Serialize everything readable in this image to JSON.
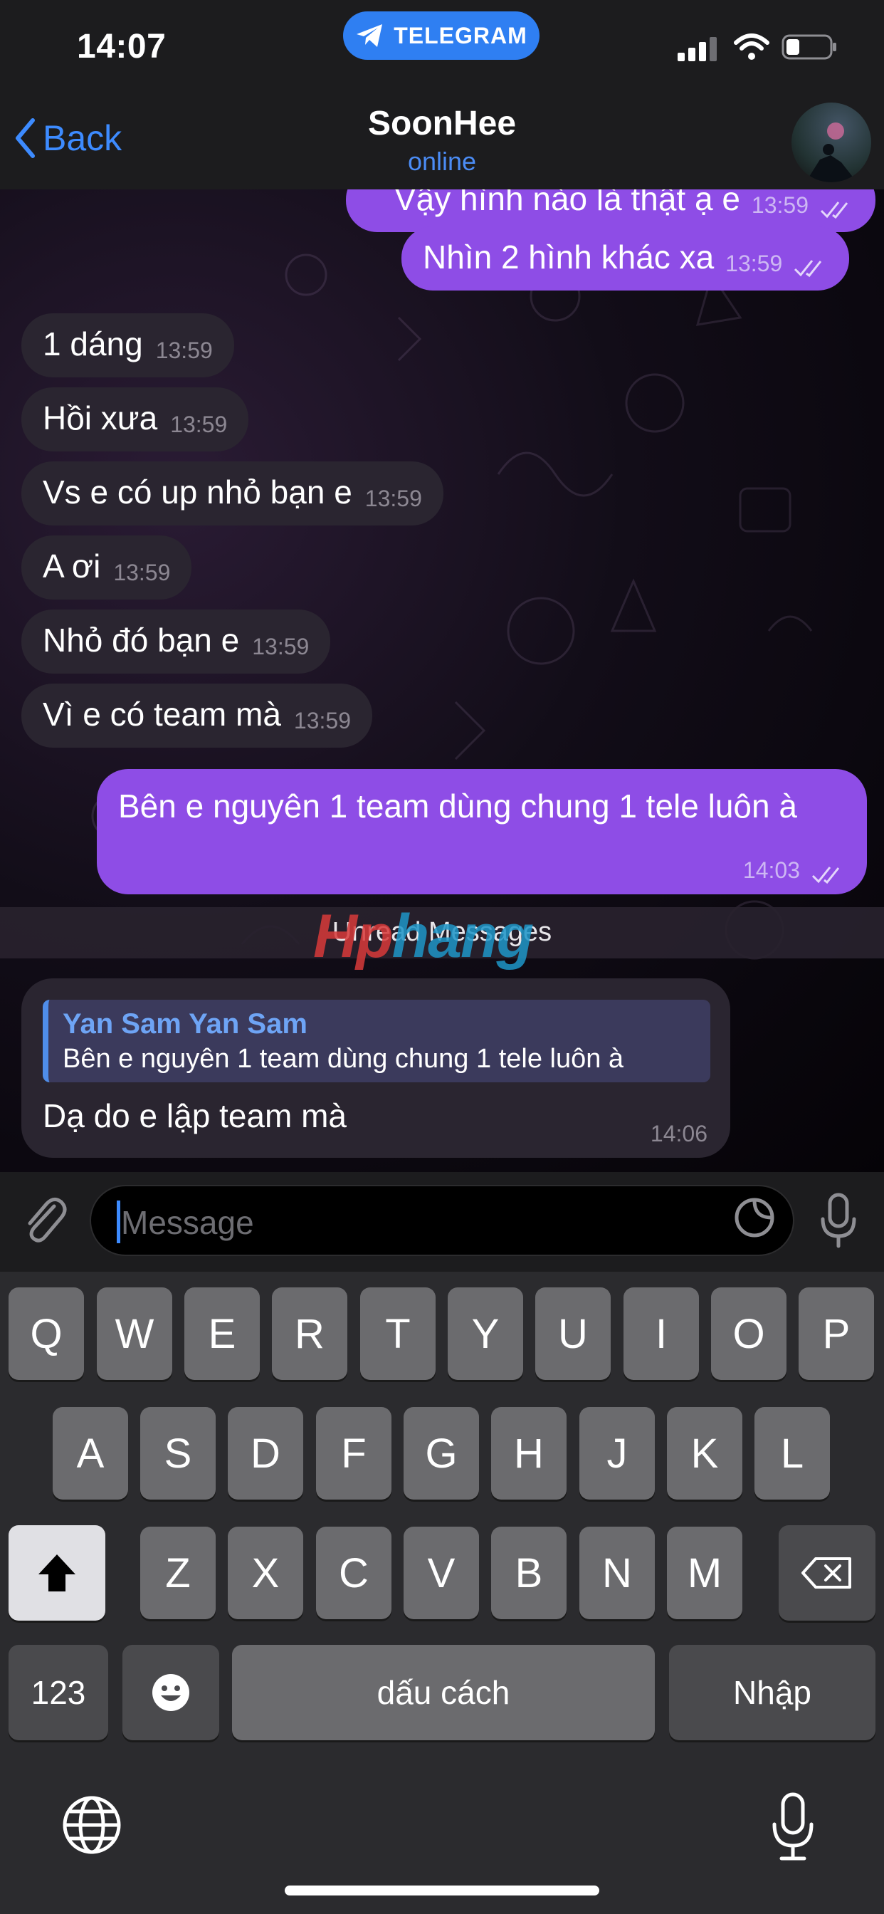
{
  "status_bar": {
    "time": "14:07",
    "app_pill": "TELEGRAM"
  },
  "header": {
    "back_label": "Back",
    "title": "SoonHee",
    "subtitle": "online"
  },
  "messages": [
    {
      "text": "Vậy hình nào là thật ạ e",
      "time": "13:59",
      "dir": "out"
    },
    {
      "text": "Nhìn 2 hình khác xa",
      "time": "13:59",
      "dir": "out"
    },
    {
      "text": "1 dáng",
      "time": "13:59",
      "dir": "in"
    },
    {
      "text": "Hồi xưa",
      "time": "13:59",
      "dir": "in"
    },
    {
      "text": "Vs e có up nhỏ bạn e",
      "time": "13:59",
      "dir": "in"
    },
    {
      "text": "A ơi",
      "time": "13:59",
      "dir": "in"
    },
    {
      "text": "Nhỏ đó bạn e",
      "time": "13:59",
      "dir": "in"
    },
    {
      "text": "Vì e có team mà",
      "time": "13:59",
      "dir": "in"
    },
    {
      "text": "Bên e nguyên 1 team dùng chung 1 tele luôn à",
      "time": "14:03",
      "dir": "out"
    }
  ],
  "unread_label": "Unread Messages",
  "watermark": "Hphang",
  "reply_message": {
    "quote_name": "Yan Sam Yan Sam",
    "quote_text": "Bên e nguyên 1 team dùng chung 1 tele luôn à",
    "text": "Dạ do e lập team mà",
    "time": "14:06"
  },
  "input": {
    "placeholder": "Message"
  },
  "keyboard": {
    "row1": [
      "Q",
      "W",
      "E",
      "R",
      "T",
      "Y",
      "U",
      "I",
      "O",
      "P"
    ],
    "row2": [
      "A",
      "S",
      "D",
      "F",
      "G",
      "H",
      "J",
      "K",
      "L"
    ],
    "row3": [
      "Z",
      "X",
      "C",
      "V",
      "B",
      "N",
      "M"
    ],
    "numbers_key": "123",
    "space_label": "dấu cách",
    "enter_label": "Nhập"
  },
  "colors": {
    "accent": "#3d8bff",
    "outgoing": "#8e4de6",
    "incoming": "#2a2530"
  }
}
